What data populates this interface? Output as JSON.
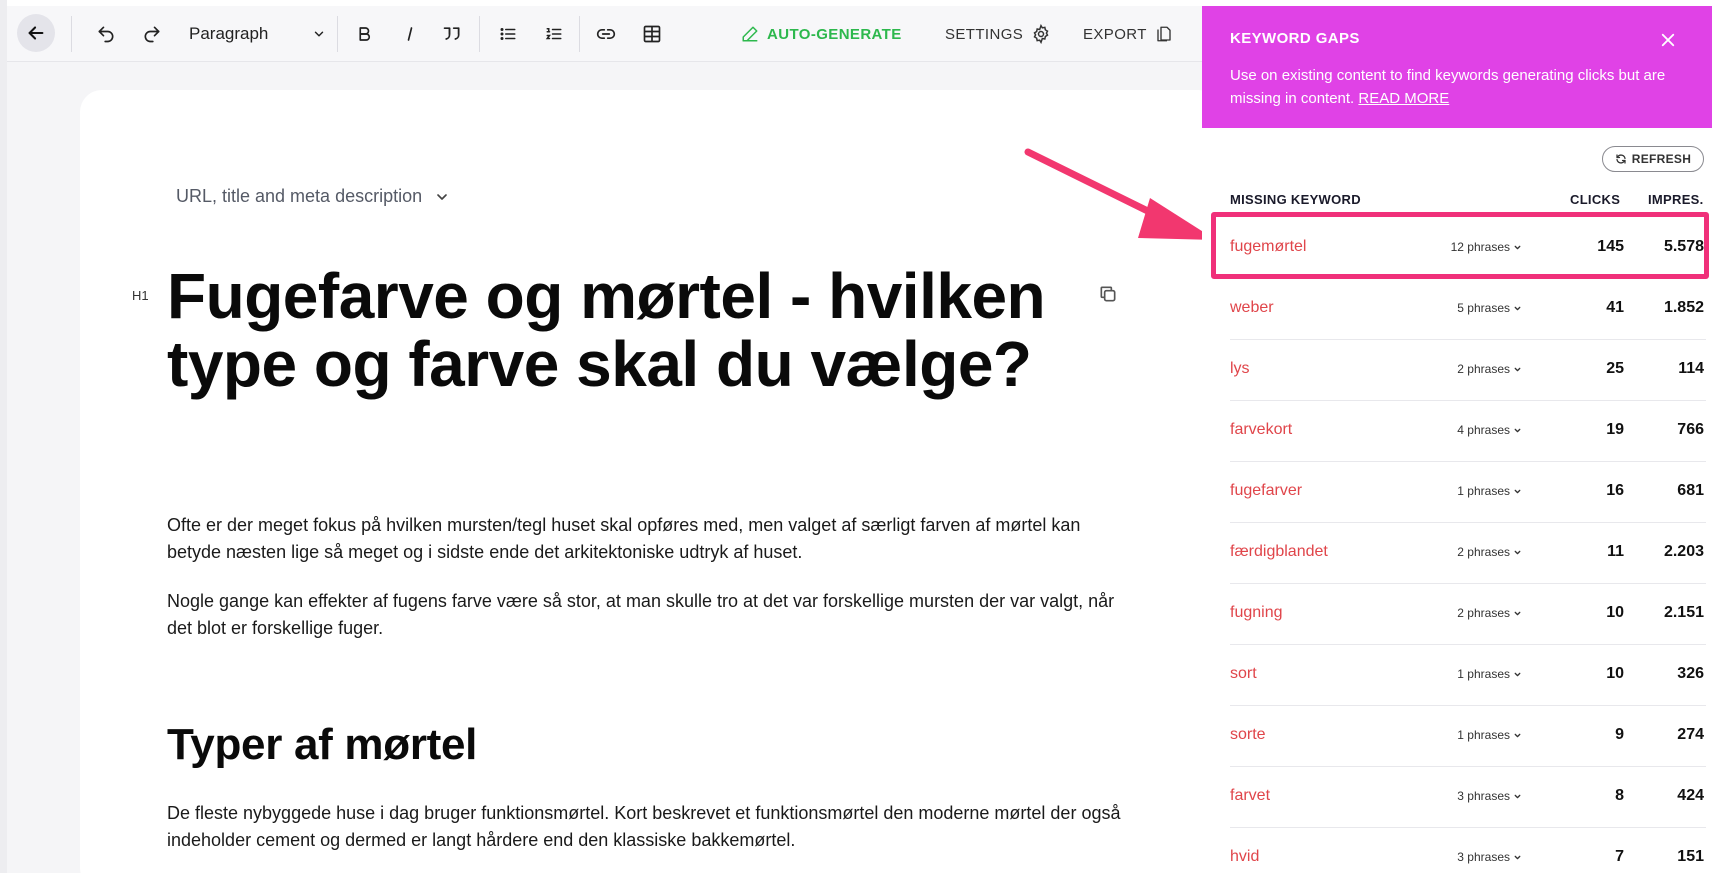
{
  "toolbar": {
    "block_type": "Paragraph",
    "auto_generate": "AUTO-GENERATE",
    "settings": "SETTINGS",
    "export": "EXPORT"
  },
  "editor": {
    "meta_toggle": "URL, title and meta description",
    "h1_tag": "H1",
    "h1": "Fugefarve og mørtel - hvilken type og farve skal du vælge?",
    "p1": "Ofte er der meget fokus på hvilken mursten/tegl huset skal opføres med, men valget af særligt farven af mørtel kan betyde næsten lige så meget og i sidste ende det arkitektoniske udtryk af huset.",
    "p2": "Nogle gange kan effekter af fugens farve være så stor, at man skulle tro at det var forskellige mursten der var valgt, når det blot er forskellige fuger.",
    "h2": "Typer af mørtel",
    "p3": "De fleste nybyggede huse i dag bruger funktionsmørtel. Kort beskrevet et funktionsmørtel den moderne mørtel der også indeholder cement og dermed er langt hårdere end den klassiske bakkemørtel."
  },
  "panel": {
    "title": "KEYWORD GAPS",
    "description": "Use on existing content to find keywords generating clicks but are missing in content.",
    "read_more": "READ MORE",
    "refresh": "REFRESH",
    "col_keyword": "MISSING KEYWORD",
    "col_clicks": "CLICKS",
    "col_impres": "IMPRES.",
    "rows": [
      {
        "keyword": "fugemørtel",
        "phrases": "12 phrases",
        "clicks": "145",
        "impressions": "5.578"
      },
      {
        "keyword": "weber",
        "phrases": "5 phrases",
        "clicks": "41",
        "impressions": "1.852"
      },
      {
        "keyword": "lys",
        "phrases": "2 phrases",
        "clicks": "25",
        "impressions": "114"
      },
      {
        "keyword": "farvekort",
        "phrases": "4 phrases",
        "clicks": "19",
        "impressions": "766"
      },
      {
        "keyword": "fugefarver",
        "phrases": "1 phrases",
        "clicks": "16",
        "impressions": "681"
      },
      {
        "keyword": "færdigblandet",
        "phrases": "2 phrases",
        "clicks": "11",
        "impressions": "2.203"
      },
      {
        "keyword": "fugning",
        "phrases": "2 phrases",
        "clicks": "10",
        "impressions": "2.151"
      },
      {
        "keyword": "sort",
        "phrases": "1 phrases",
        "clicks": "10",
        "impressions": "326"
      },
      {
        "keyword": "sorte",
        "phrases": "1 phrases",
        "clicks": "9",
        "impressions": "274"
      },
      {
        "keyword": "farvet",
        "phrases": "3 phrases",
        "clicks": "8",
        "impressions": "424"
      },
      {
        "keyword": "hvid",
        "phrases": "3 phrases",
        "clicks": "7",
        "impressions": "151"
      }
    ]
  },
  "colors": {
    "panel_header": "#e042e6",
    "keyword_text": "#e0454a",
    "highlight": "#f0307a",
    "auto_generate": "#2db84d"
  },
  "icons": [
    "back-arrow-icon",
    "undo-icon",
    "redo-icon",
    "chevron-down-icon",
    "bold-icon",
    "italic-icon",
    "quote-icon",
    "bullet-list-icon",
    "numbered-list-icon",
    "link-icon",
    "table-icon",
    "pencil-icon",
    "gear-icon",
    "document-icon",
    "copy-icon",
    "close-icon",
    "refresh-icon"
  ]
}
